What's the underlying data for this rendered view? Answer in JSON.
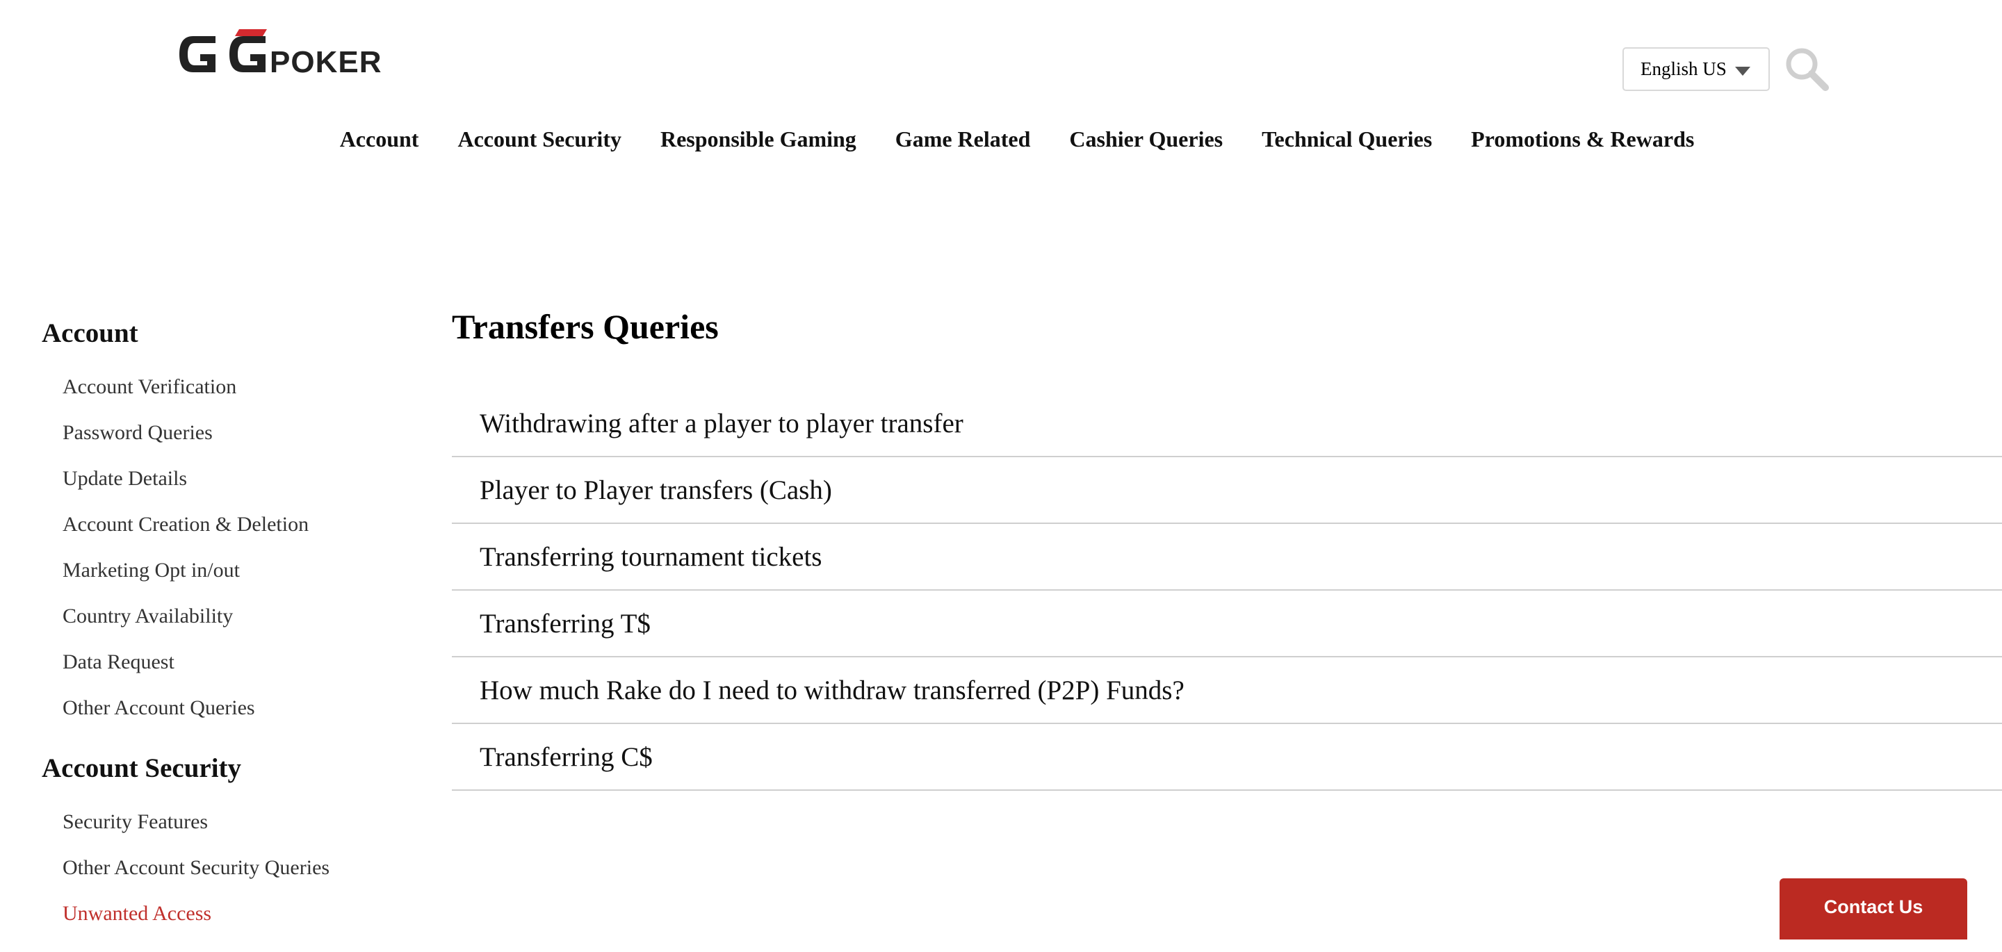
{
  "header": {
    "logo_text": "GGPOKER",
    "language": {
      "selected": "English US"
    },
    "search_icon": "search-icon"
  },
  "nav": {
    "items": [
      {
        "label": "Account"
      },
      {
        "label": "Account Security"
      },
      {
        "label": "Responsible Gaming"
      },
      {
        "label": "Game Related"
      },
      {
        "label": "Cashier Queries"
      },
      {
        "label": "Technical Queries"
      },
      {
        "label": "Promotions & Rewards"
      }
    ]
  },
  "sidebar": {
    "groups": [
      {
        "title": "Account",
        "items": [
          {
            "label": "Account Verification"
          },
          {
            "label": "Password Queries"
          },
          {
            "label": "Update Details"
          },
          {
            "label": "Account Creation & Deletion"
          },
          {
            "label": "Marketing Opt in/out"
          },
          {
            "label": "Country Availability"
          },
          {
            "label": "Data Request"
          },
          {
            "label": "Other Account Queries"
          }
        ]
      },
      {
        "title": "Account Security",
        "items": [
          {
            "label": "Security Features"
          },
          {
            "label": "Other Account Security Queries"
          },
          {
            "label": "Unwanted Access"
          }
        ]
      }
    ],
    "active_item": "Unwanted Access"
  },
  "main": {
    "title": "Transfers Queries",
    "articles": [
      {
        "label": "Withdrawing after a player to player transfer"
      },
      {
        "label": "Player to Player transfers (Cash)"
      },
      {
        "label": "Transferring tournament tickets"
      },
      {
        "label": "Transferring T$"
      },
      {
        "label": "How much Rake do I need to withdraw transferred (P2P) Funds?"
      },
      {
        "label": "Transferring C$"
      }
    ]
  },
  "contact": {
    "label": "Contact Us"
  },
  "colors": {
    "accent_red": "#bb2a22",
    "active_link": "#c0302c",
    "divider": "#cfcfcf",
    "logo_red": "#d42a2f"
  }
}
